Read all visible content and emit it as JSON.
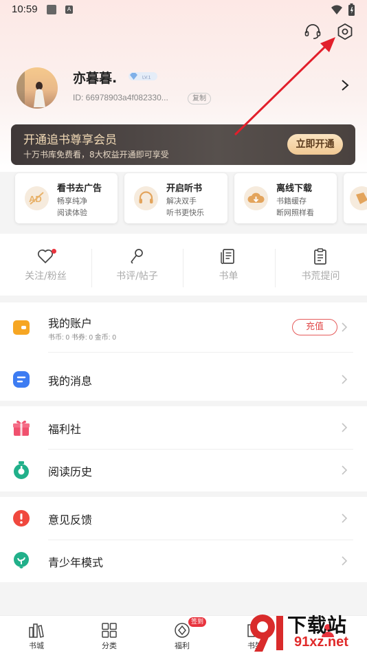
{
  "status_bar": {
    "time": "10:59",
    "notif_letter": "A"
  },
  "header": {
    "support_icon": "headset-icon",
    "settings_icon": "settings-hexagon-icon"
  },
  "profile": {
    "username": "亦暮暮.",
    "level": "LV.1",
    "user_id": "ID: 66978903a4f082330...",
    "copy_label": "复制"
  },
  "vip": {
    "title": "开通追书尊享会员",
    "subtitle": "十万书库免费看，8大权益开通即可享受",
    "button": "立即开通",
    "colors": {
      "bg": "#4a4240",
      "title": "#f1d9b5",
      "button": "#f4d2a2"
    }
  },
  "features": [
    {
      "title": "看书去广告",
      "line1": "畅享纯净",
      "line2": "阅读体验",
      "icon": "no-ad-icon"
    },
    {
      "title": "开启听书",
      "line1": "解决双手",
      "line2": "听书更快乐",
      "icon": "audiobook-icon"
    },
    {
      "title": "离线下载",
      "line1": "书籍缓存",
      "line2": "断网照样看",
      "icon": "cloud-download-icon"
    },
    {
      "title": "",
      "line1": "",
      "line2": "",
      "icon": "coupon-icon"
    }
  ],
  "social": [
    {
      "label": "关注/粉丝",
      "icon": "heart-icon",
      "has_dot": true
    },
    {
      "label": "书评/帖子",
      "icon": "microphone-icon",
      "has_dot": false
    },
    {
      "label": "书单",
      "icon": "book-list-icon",
      "has_dot": false
    },
    {
      "label": "书荒提问",
      "icon": "clipboard-icon",
      "has_dot": false
    }
  ],
  "menu": {
    "account": {
      "label": "我的账户",
      "sub": "书币: 0   书券: 0   金币: 0",
      "recharge": "充值"
    },
    "messages": {
      "label": "我的消息"
    },
    "welfare": {
      "label": "福利社"
    },
    "history": {
      "label": "阅读历史"
    },
    "feedback": {
      "label": "意见反馈"
    },
    "teen_mode": {
      "label": "青少年模式"
    }
  },
  "bottom_nav": [
    {
      "label": "书城",
      "icon": "bookstore-icon"
    },
    {
      "label": "分类",
      "icon": "grid-icon"
    },
    {
      "label": "福利",
      "icon": "welfare-icon",
      "badge": "签到"
    },
    {
      "label": "书架",
      "icon": "bookshelf-icon"
    },
    {
      "label": "",
      "icon": "mine-icon"
    }
  ],
  "watermark": {
    "title": "下载站",
    "url": "91xz.net"
  },
  "colors": {
    "accent_red": "#e8343e",
    "arrow_red": "#e21f2b"
  }
}
